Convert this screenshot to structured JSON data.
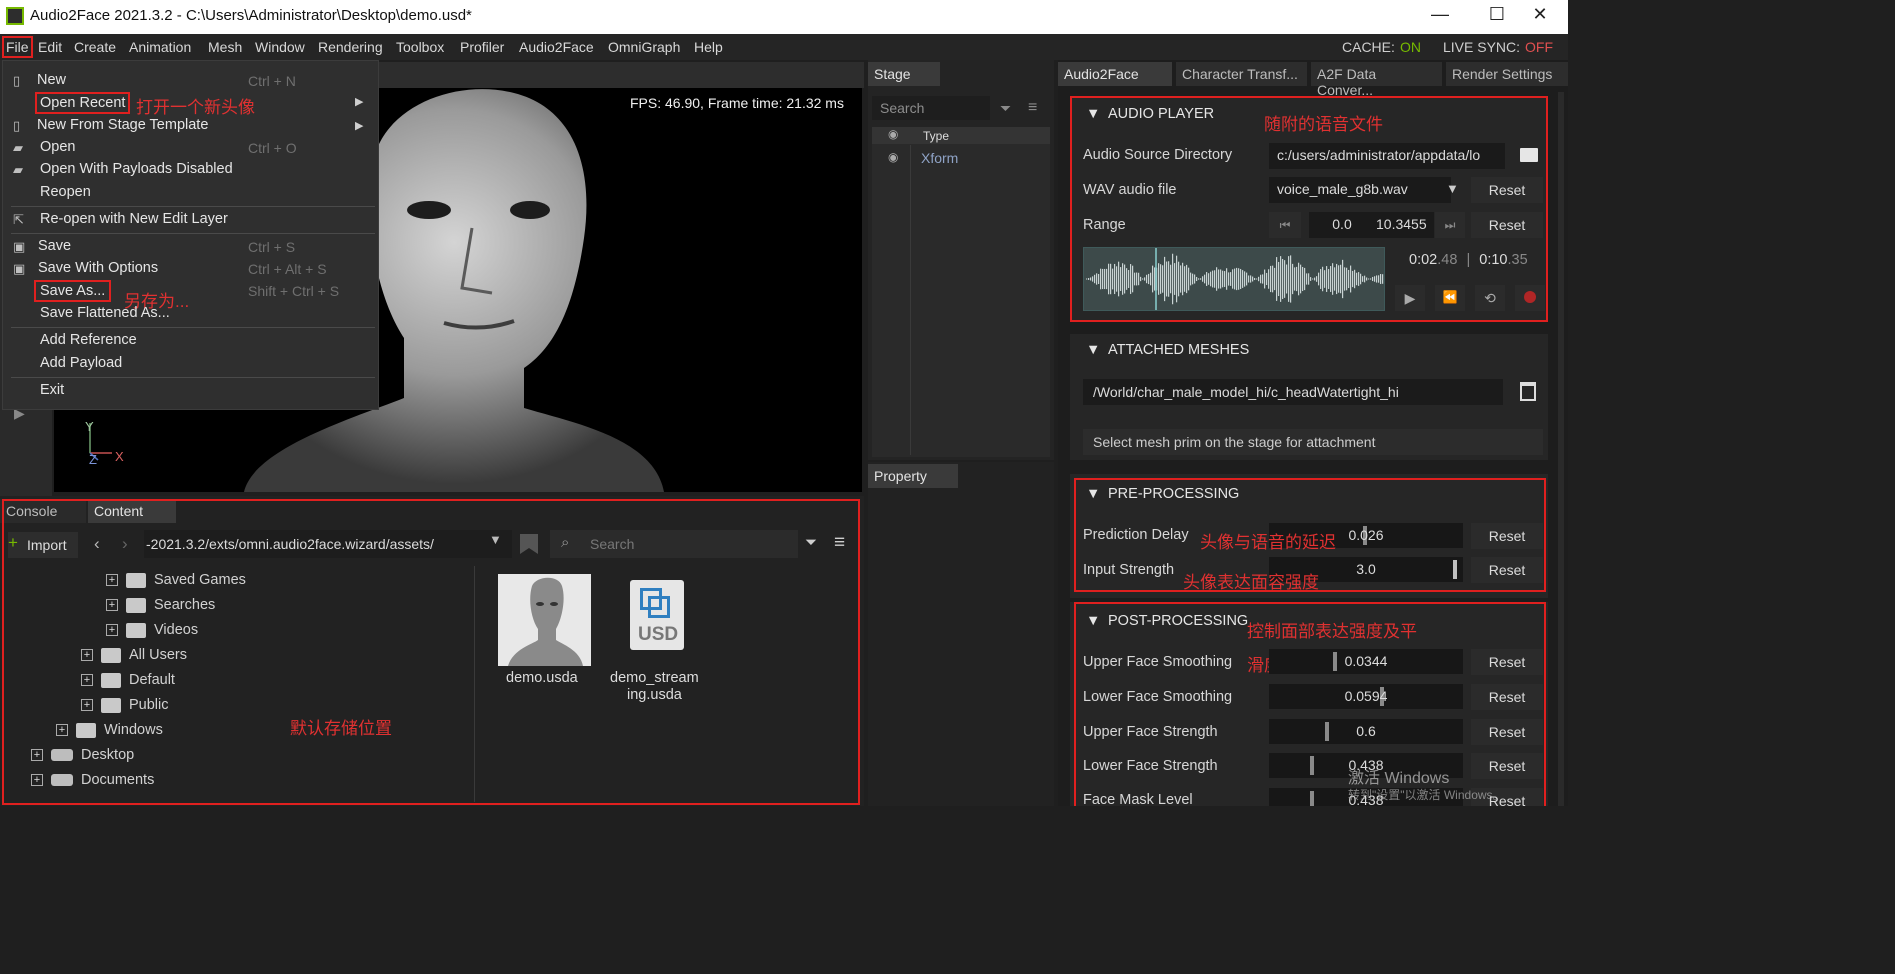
{
  "window": {
    "title": "Audio2Face 2021.3.2 - C:\\Users\\Administrator\\Desktop\\demo.usd*",
    "minimize": "—",
    "maximize": "☐",
    "close": "✕"
  },
  "menubar": {
    "items": [
      "File",
      "Edit",
      "Create",
      "Animation",
      "Mesh",
      "Window",
      "Rendering",
      "Toolbox",
      "Profiler",
      "Audio2Face",
      "OmniGraph",
      "Help"
    ],
    "cache_label": "CACHE:",
    "cache_value": "ON",
    "live_label": "LIVE SYNC:",
    "live_value": "OFF"
  },
  "file_menu": {
    "new": "New",
    "new_sc": "Ctrl + N",
    "open_recent": "Open Recent",
    "new_from_template": "New From Stage Template",
    "open": "Open",
    "open_sc": "Ctrl + O",
    "open_payloads_disabled": "Open With Payloads Disabled",
    "reopen": "Reopen",
    "reopen_edit_layer": "Re-open with New Edit Layer",
    "save": "Save",
    "save_sc": "Ctrl + S",
    "save_options": "Save With Options",
    "save_options_sc": "Ctrl + Alt + S",
    "save_as": "Save As...",
    "save_as_sc": "Shift + Ctrl + S",
    "save_flattened": "Save Flattened As...",
    "add_reference": "Add Reference",
    "add_payload": "Add Payload",
    "exit": "Exit"
  },
  "annotations": {
    "open_recent_note": "打开一个新头像",
    "save_as_note": "另存为...",
    "audio_note": "随附的语音文件",
    "delay_note": "头像与语音的延迟",
    "strength_note": "头像表达面容强度",
    "post_note_1": "控制面部表达强度及平",
    "post_note_2": "滑度",
    "storage_note": "默认存储位置"
  },
  "viewport": {
    "fps": "FPS: 46.90, Frame time: 21.32 ms",
    "axis_y": "Y",
    "axis_z": "Z",
    "axis_x": "X"
  },
  "stage": {
    "tab": "Stage",
    "search_placeholder": "Search",
    "col_type": "Type",
    "row_type": "Xform"
  },
  "property": {
    "tab": "Property"
  },
  "content": {
    "tabs": [
      "Console",
      "Content"
    ],
    "import": "Import",
    "path": "-2021.3.2/exts/omni.audio2face.wizard/assets/",
    "search_placeholder": "Search",
    "tree": [
      {
        "label": "Saved Games",
        "level": 3,
        "kind": "folder"
      },
      {
        "label": "Searches",
        "level": 3,
        "kind": "folder"
      },
      {
        "label": "Videos",
        "level": 3,
        "kind": "folder"
      },
      {
        "label": "All Users",
        "level": 2,
        "kind": "folder"
      },
      {
        "label": "Default",
        "level": 2,
        "kind": "folder"
      },
      {
        "label": "Public",
        "level": 2,
        "kind": "folder"
      },
      {
        "label": "Windows",
        "level": 1,
        "kind": "folder"
      },
      {
        "label": "Desktop",
        "level": 0,
        "kind": "drive"
      },
      {
        "label": "Documents",
        "level": 0,
        "kind": "drive"
      }
    ],
    "files": [
      {
        "name": "demo.usda",
        "kind": "thumb"
      },
      {
        "name_line1": "demo_stream",
        "name_line2": "ing.usda",
        "kind": "usd",
        "badge": "USD"
      }
    ]
  },
  "a2f_tabs": [
    "Audio2Face",
    "Character Transf...",
    "A2F Data Conver...",
    "Render Settings"
  ],
  "audio_player": {
    "header": "AUDIO PLAYER",
    "src_label": "Audio Source Directory",
    "src_value": "c:/users/administrator/appdata/lo",
    "wav_label": "WAV audio file",
    "wav_value": "voice_male_g8b.wav",
    "range_label": "Range",
    "range_start": "0.0",
    "range_end": "10.3455",
    "reset": "Reset",
    "time_current": "0:02",
    "time_current_frac": ".48",
    "time_sep": "|",
    "time_total": "0:10",
    "time_total_frac": ".35",
    "playhead": 0.24
  },
  "attached_meshes": {
    "header": "ATTACHED MESHES",
    "mesh_path": "/World/char_male_model_hi/c_headWatertight_hi",
    "hint": "Select mesh prim on the stage for attachment"
  },
  "pre_processing": {
    "header": "PRE-PROCESSING",
    "rows": [
      {
        "label": "Prediction Delay",
        "value": "0.026",
        "level": 0.5
      },
      {
        "label": "Input Strength",
        "value": "3.0",
        "level": 0.98
      }
    ]
  },
  "post_processing": {
    "header": "POST-PROCESSING",
    "rows": [
      {
        "label": "Upper Face Smoothing",
        "value": "0.0344",
        "level": 0.34
      },
      {
        "label": "Lower Face Smoothing",
        "value": "0.0594",
        "level": 0.59
      },
      {
        "label": "Upper Face Strength",
        "value": "0.6",
        "level": 0.3
      },
      {
        "label": "Lower Face Strength",
        "value": "0.438",
        "level": 0.22
      },
      {
        "label": "Face Mask Level",
        "value": "0.438",
        "level": 0.22
      }
    ]
  },
  "watermark": {
    "line1": "激活 Windows",
    "line2": "转到\"设置\"以激活 Windows。"
  },
  "colors": {
    "accent_red": "#e0201f",
    "cache_on": "#76b900",
    "live_off": "#e05050"
  }
}
